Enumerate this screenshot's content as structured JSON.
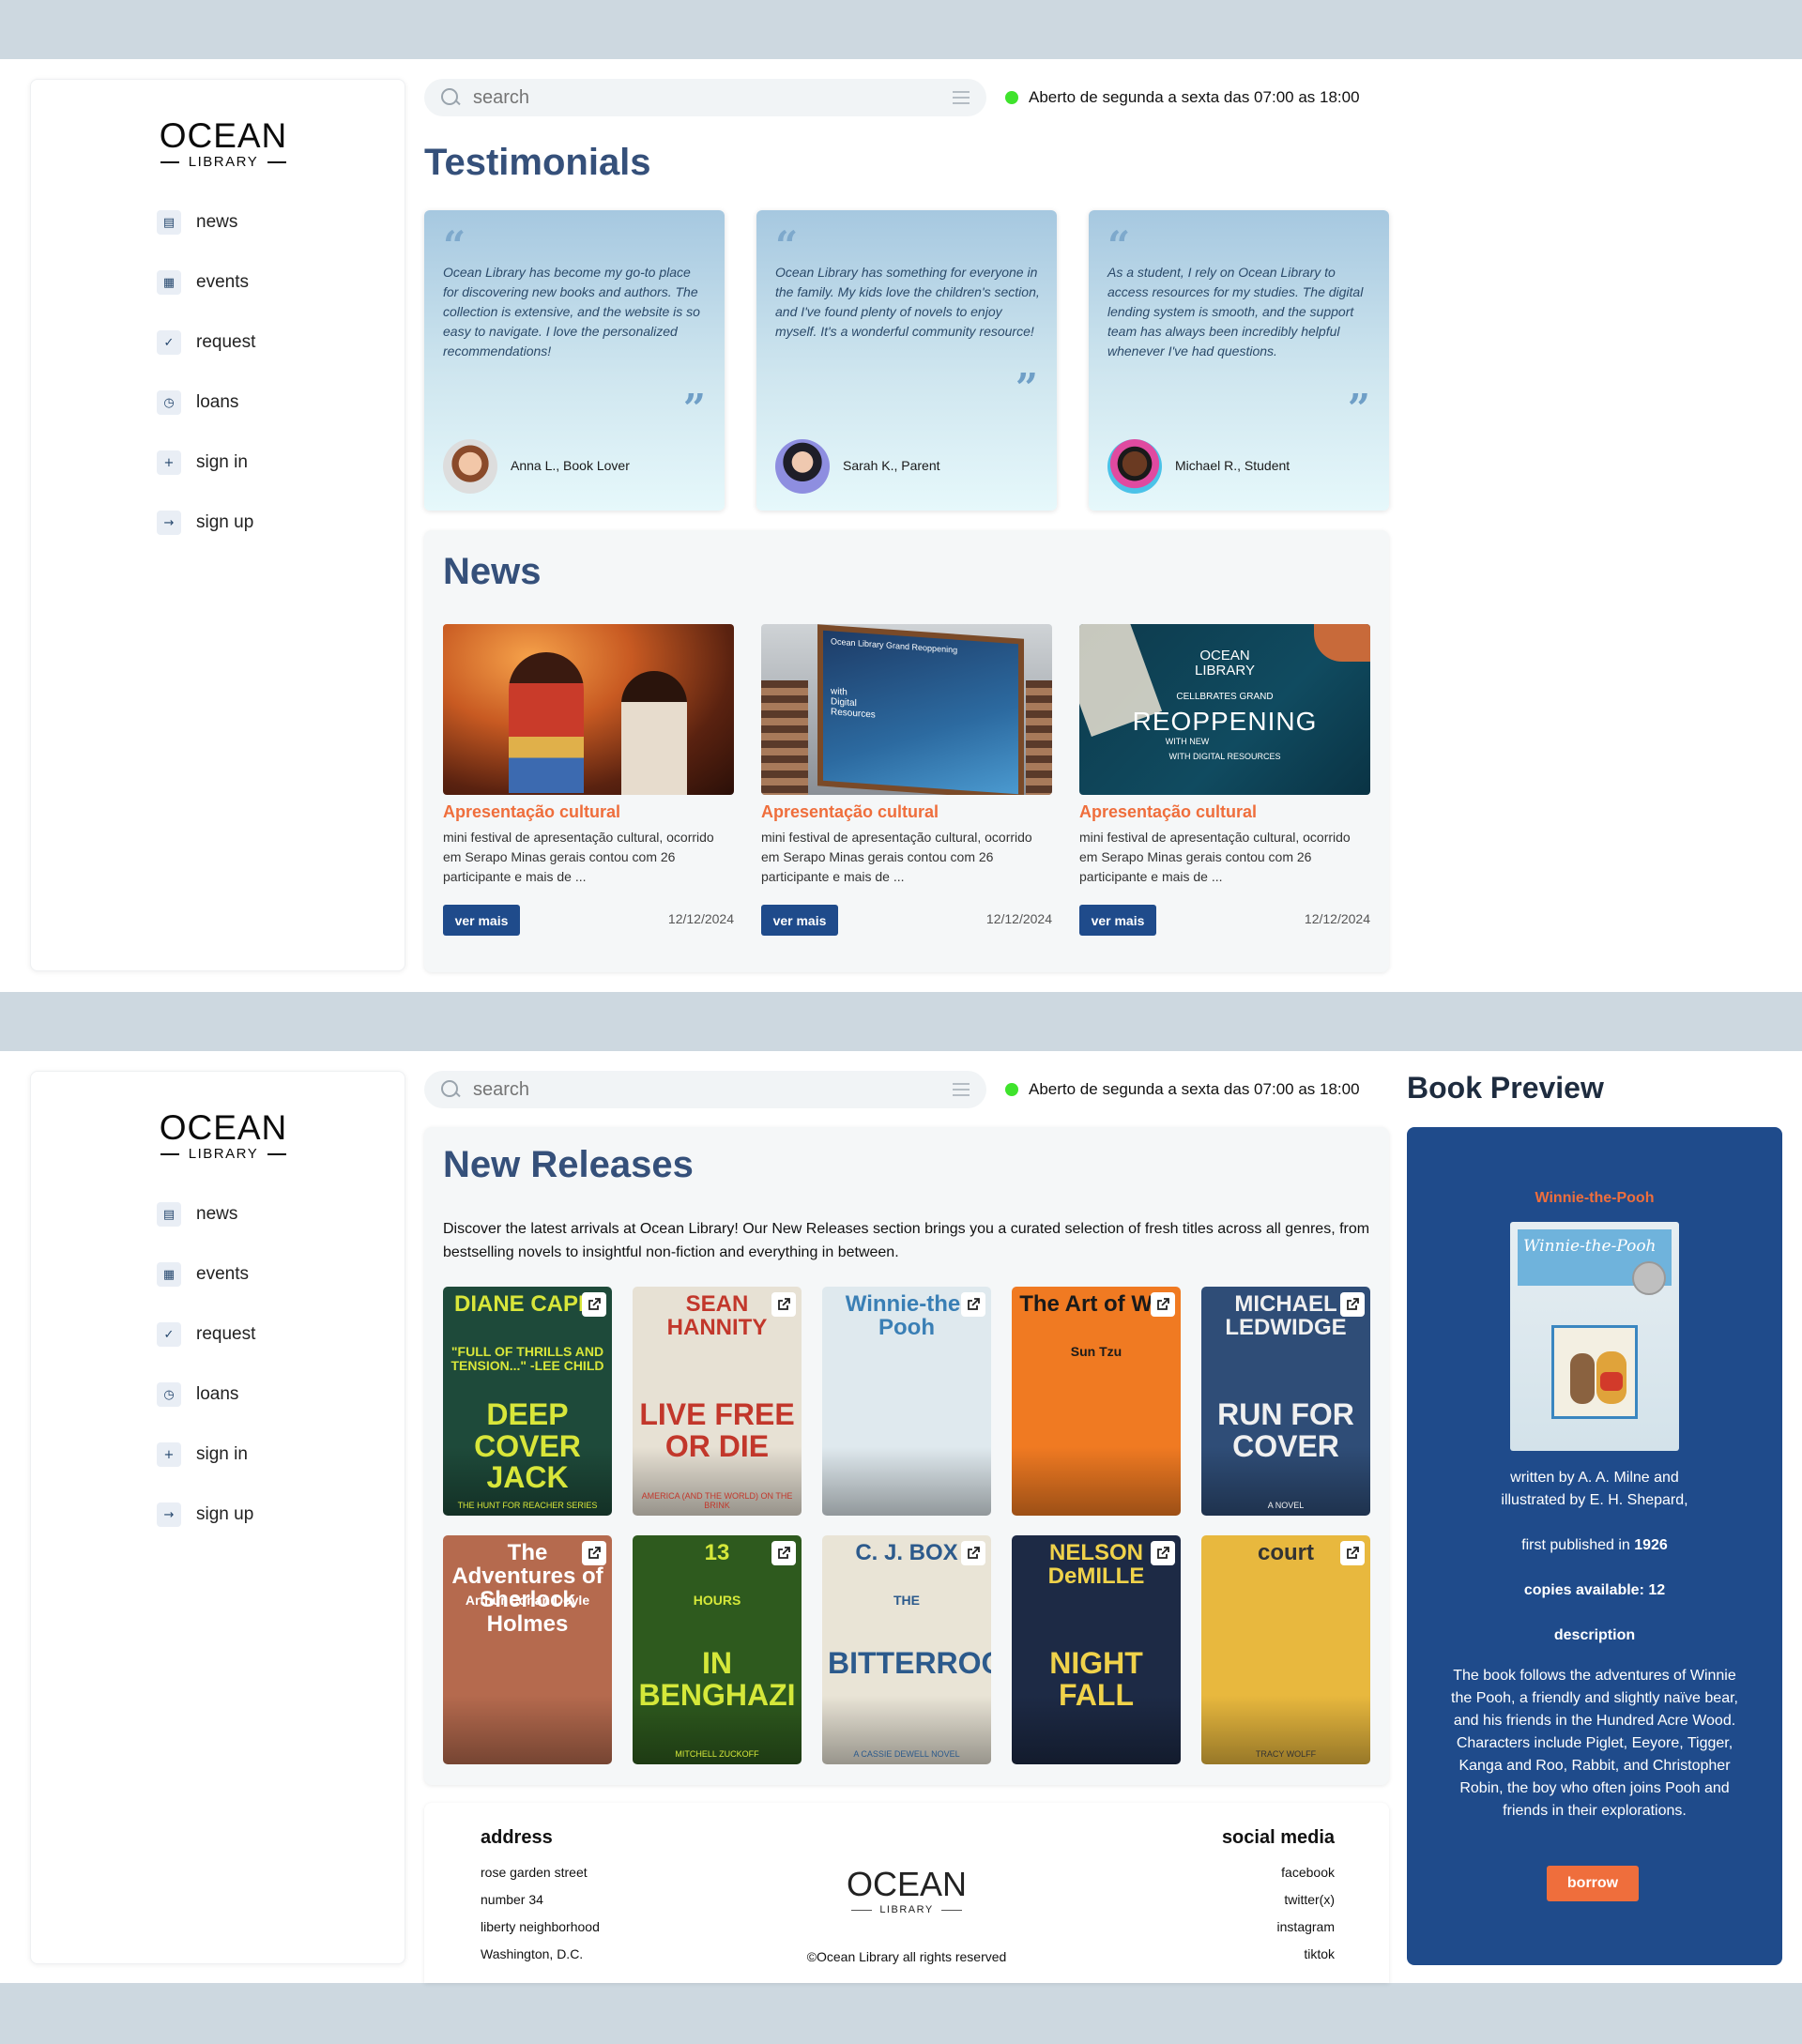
{
  "logo": {
    "main": "OCEAN",
    "sub": "LIBRARY"
  },
  "nav": [
    {
      "label": "news",
      "icon": "newspaper-icon",
      "glyph": "▤"
    },
    {
      "label": "events",
      "icon": "calendar-icon",
      "glyph": "▦"
    },
    {
      "label": "request",
      "icon": "document-check-icon",
      "glyph": "✓"
    },
    {
      "label": "loans",
      "icon": "document-clock-icon",
      "glyph": "◷"
    },
    {
      "label": "sign in",
      "icon": "user-plus-icon",
      "glyph": "+"
    },
    {
      "label": "sign up",
      "icon": "login-arrow-icon",
      "glyph": "→"
    }
  ],
  "search": {
    "placeholder": "search"
  },
  "status": {
    "text": "Aberto de segunda a sexta das 07:00 as 18:00",
    "color": "#3fe32c"
  },
  "testimonials": {
    "title": "Testimonials",
    "items": [
      {
        "text": "Ocean Library has become my go-to place for discovering new books and authors. The collection is extensive, and the website is so easy to navigate. I love the personalized recommendations!",
        "name": "Anna L., Book Lover"
      },
      {
        "text": "Ocean Library has something for everyone in the family. My kids love the children's section, and I've found plenty of novels to enjoy myself. It's a wonderful community resource!",
        "name": "Sarah K., Parent"
      },
      {
        "text": "As a student, I rely on Ocean Library to access resources for my studies. The digital lending system is smooth, and the support team has always been incredibly helpful whenever I've had questions.",
        "name": "Michael R., Student"
      }
    ]
  },
  "news": {
    "title": "News",
    "items": [
      {
        "title": "Apresentação cultural",
        "text": "mini festival de apresentação cultural, ocorrido em Serapo Minas gerais contou com 26 participante e mais de ...",
        "button": "ver mais",
        "date": "12/12/2024",
        "image": "concert-photo"
      },
      {
        "title": "Apresentação cultural",
        "text": "mini festival de apresentação cultural, ocorrido em Serapo Minas gerais contou com 26 participante e mais de ...",
        "button": "ver mais",
        "date": "12/12/2024",
        "image": "library-screen-photo",
        "image_text": [
          "Ocean Library Grand Reoppening",
          "with",
          "Digital",
          "Resources"
        ]
      },
      {
        "title": "Apresentação cultural",
        "text": "mini festival de apresentação cultural, ocorrido em Serapo Minas gerais contou com 26 participante e mais de ...",
        "button": "ver mais",
        "date": "12/12/2024",
        "image": "reopening-banner",
        "image_text": [
          "OCEAN",
          "LIBRARY",
          "CELLBRATES GRAND",
          "REOPPENING",
          "WITH NEW",
          "WITH DIGITAL RESOURCES"
        ]
      }
    ]
  },
  "new_releases": {
    "title": "New Releases",
    "description": "Discover the latest arrivals at Ocean Library! Our New Releases section brings you a curated selection of fresh titles across all genres, from bestselling novels to insightful non-fiction and everything in between.",
    "books": [
      {
        "top": "DIANE CAPRI",
        "mid": "\"FULL OF THRILLS AND TENSION...\" -LEE CHILD",
        "bottom": "DEEP COVER JACK",
        "foot": "THE HUNT FOR REACHER SERIES",
        "bg": "#1e4a3a",
        "fg": "#d8e63a"
      },
      {
        "top": "SEAN HANNITY",
        "mid": "",
        "bottom": "LIVE FREE OR DIE",
        "foot": "AMERICA (AND THE WORLD) ON THE BRINK",
        "bg": "#e7e1d4",
        "fg": "#c2372b"
      },
      {
        "top": "Winnie-the-Pooh",
        "mid": "",
        "bottom": "",
        "foot": "",
        "bg": "#dfe9ee",
        "fg": "#3a7fb5"
      },
      {
        "top": "The Art of War",
        "mid": "Sun Tzu",
        "bottom": "",
        "foot": "",
        "bg": "#f07a22",
        "fg": "#1a1a1a"
      },
      {
        "top": "MICHAEL LEDWIDGE",
        "mid": "",
        "bottom": "RUN FOR COVER",
        "foot": "A NOVEL",
        "bg": "#2f4d77",
        "fg": "#f0f0f0"
      },
      {
        "top": "The Adventures of Sherlock Holmes",
        "mid": "Arthur Conan Doyle",
        "bottom": "",
        "foot": "",
        "bg": "#b56a4e",
        "fg": "#ffffff"
      },
      {
        "top": "13",
        "mid": "HOURS",
        "bottom": "IN BENGHAZI",
        "foot": "MITCHELL ZUCKOFF",
        "bg": "#2e5a1e",
        "fg": "#d5e83a"
      },
      {
        "top": "C. J. BOX",
        "mid": "THE",
        "bottom": "BITTERROOTS",
        "foot": "A CASSIE DEWELL NOVEL",
        "bg": "#e9e4d6",
        "fg": "#2c5a8c"
      },
      {
        "top": "NELSON DeMILLE",
        "mid": "",
        "bottom": "NIGHT FALL",
        "foot": "",
        "bg": "#1d2a45",
        "fg": "#f0d24a"
      },
      {
        "top": "court",
        "mid": "",
        "bottom": "",
        "foot": "TRACY WOLFF",
        "bg": "#e8b83e",
        "fg": "#333333"
      }
    ]
  },
  "footer": {
    "address_title": "address",
    "address": [
      "rose garden street",
      "number 34",
      "liberty neighborhood",
      "Washington, D.C."
    ],
    "logo_main": "OCEAN",
    "logo_sub": "LIBRARY",
    "copyright": "©Ocean Library all rights reserved",
    "social_title": "social media",
    "social": [
      "facebook",
      "twitter(x)",
      "instagram",
      "tiktok"
    ]
  },
  "preview": {
    "heading": "Book Preview",
    "title": "Winnie-the-Pooh",
    "cover_text": "Winnie-the-Pooh",
    "written": "written by A. A. Milne and",
    "illustrated": "illustrated by E. H. Shepard,",
    "published_prefix": "first published in ",
    "published_year": "1926",
    "copies": "copies available: 12",
    "desc_title": "description",
    "description": "The book follows the adventures of Winnie the Pooh, a friendly and slightly naïve bear, and his friends in the Hundred Acre Wood. Characters include Piglet, Eeyore, Tigger, Kanga and Roo, Rabbit, and Christopher Robin, the boy who often joins Pooh and friends in their explorations.",
    "button": "borrow"
  },
  "colors": {
    "accent": "#1f4b8b",
    "orange": "#ef6e3c",
    "heading": "#35507a"
  }
}
